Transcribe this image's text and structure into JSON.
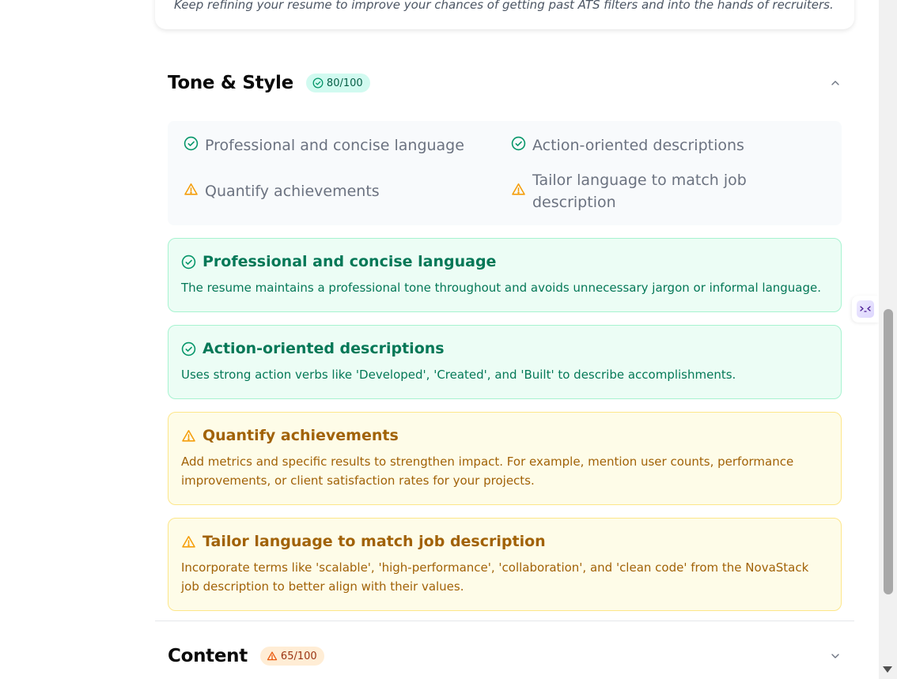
{
  "top_card": {
    "message": "Keep refining your resume to improve your chances of getting past ATS filters and into the hands of recruiters."
  },
  "tone_section": {
    "title": "Tone & Style",
    "score": "80/100",
    "summary": [
      {
        "text": "Professional and concise language",
        "status": "good"
      },
      {
        "text": "Action-oriented descriptions",
        "status": "good"
      },
      {
        "text": "Quantify achievements",
        "status": "warning"
      },
      {
        "text": "Tailor language to match job description",
        "status": "warning"
      }
    ],
    "tips": [
      {
        "title": "Professional and concise language",
        "status": "good",
        "description": "The resume maintains a professional tone throughout and avoids unnecessary jargon or informal language."
      },
      {
        "title": "Action-oriented descriptions",
        "status": "good",
        "description": "Uses strong action verbs like 'Developed', 'Created', and 'Built' to describe accomplishments."
      },
      {
        "title": "Quantify achievements",
        "status": "warning",
        "description": "Add metrics and specific results to strengthen impact. For example, mention user counts, performance improvements, or client satisfaction rates for your projects."
      },
      {
        "title": "Tailor language to match job description",
        "status": "warning",
        "description": "Incorporate terms like 'scalable', 'high-performance', 'collaboration', and 'clean code' from the NovaStack job description to better align with their values."
      }
    ]
  },
  "content_section": {
    "title": "Content",
    "score": "65/100"
  },
  "icons": {
    "good": "check-circle-icon",
    "warning": "warning-triangle-icon",
    "expanded": "chevron-up-icon",
    "collapsed": "chevron-down-icon"
  },
  "colors": {
    "good_text": "#047857",
    "good_bg": "#ecfdf5",
    "warn_text": "#a16207",
    "warn_bg": "#fefce8",
    "good_icon": "#059669",
    "warn_icon": "#f59e0b"
  }
}
